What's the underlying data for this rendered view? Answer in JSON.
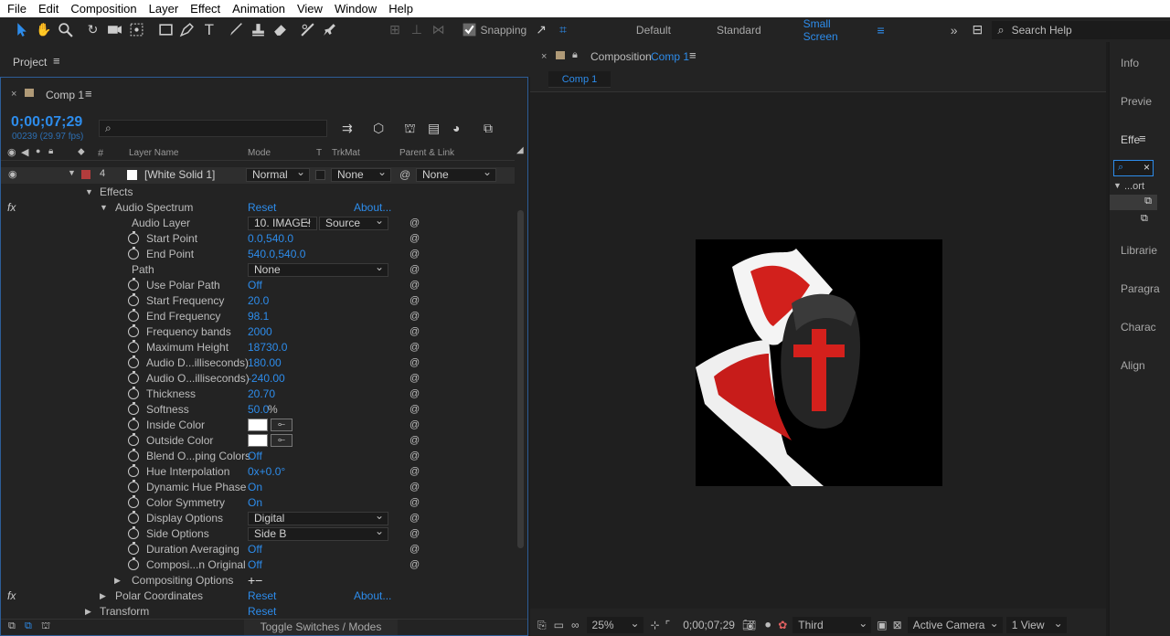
{
  "menu": [
    "File",
    "Edit",
    "Composition",
    "Layer",
    "Effect",
    "Animation",
    "View",
    "Window",
    "Help"
  ],
  "toolbar": {
    "snapping_label": "Snapping",
    "workspaces": [
      "Default",
      "Standard",
      "Small Screen"
    ],
    "search_placeholder": "Search Help"
  },
  "project": {
    "title": "Project",
    "comp_tab": "Comp 1",
    "timecode": "0;00;07;29",
    "frame_info": "00239 (29.97 fps)"
  },
  "timeline": {
    "headers": {
      "hash": "#",
      "layer_name": "Layer Name",
      "mode": "Mode",
      "t": "T",
      "trkmat": "TrkMat",
      "parent": "Parent & Link"
    },
    "layer": {
      "index": "4",
      "name": "[White Solid 1]",
      "mode": "Normal",
      "trkmat": "None",
      "parent": "None"
    },
    "effects_label": "Effects",
    "effect_name": "Audio Spectrum",
    "reset": "Reset",
    "about": "About...",
    "props": [
      {
        "label": "Audio Layer",
        "value": "10. IMAGE!",
        "value2": "Source",
        "type": "dual"
      },
      {
        "label": "Start Point",
        "value": "0.0,540.0",
        "type": "text"
      },
      {
        "label": "End Point",
        "value": "540.0,540.0",
        "type": "text"
      },
      {
        "label": "Path",
        "value": "None",
        "type": "dropdown"
      },
      {
        "label": "Use Polar Path",
        "value": "Off",
        "type": "text"
      },
      {
        "label": "Start Frequency",
        "value": "20.0",
        "type": "text"
      },
      {
        "label": "End Frequency",
        "value": "98.1",
        "type": "text"
      },
      {
        "label": "Frequency bands",
        "value": "2000",
        "type": "text"
      },
      {
        "label": "Maximum Height",
        "value": "18730.0",
        "type": "text"
      },
      {
        "label": "Audio D...illiseconds)",
        "value": "180.00",
        "type": "text"
      },
      {
        "label": "Audio O...illiseconds)",
        "value": "-240.00",
        "type": "text"
      },
      {
        "label": "Thickness",
        "value": "20.70",
        "type": "text"
      },
      {
        "label": "Softness",
        "value": "50.0",
        "suffix": "%",
        "type": "text"
      },
      {
        "label": "Inside Color",
        "type": "color"
      },
      {
        "label": "Outside Color",
        "type": "color"
      },
      {
        "label": "Blend O...ping Colors",
        "value": "Off",
        "type": "text"
      },
      {
        "label": "Hue Interpolation",
        "value": "0x+0.0°",
        "type": "text"
      },
      {
        "label": "Dynamic Hue Phase",
        "value": "On",
        "type": "text"
      },
      {
        "label": "Color Symmetry",
        "value": "On",
        "type": "text"
      },
      {
        "label": "Display Options",
        "value": "Digital",
        "type": "dropdown"
      },
      {
        "label": "Side Options",
        "value": "Side B",
        "type": "dropdown"
      },
      {
        "label": "Duration Averaging",
        "value": "Off",
        "type": "text"
      },
      {
        "label": "Composi...n Original",
        "value": "Off",
        "type": "text"
      }
    ],
    "compositing_options": "Compositing Options",
    "polar_coordinates": "Polar Coordinates",
    "transform": "Transform",
    "toggle_switches": "Toggle Switches / Modes"
  },
  "composition": {
    "label": "Composition",
    "name": "Comp 1",
    "tab": "Comp 1",
    "zoom": "25%",
    "timecode": "0;00;07;29",
    "resolution": "Third",
    "camera": "Active Camera",
    "views": "1 View"
  },
  "right_panels": [
    "Info",
    "Previe",
    "Effe",
    "Librarie",
    "Paragra",
    "Charac",
    "Align"
  ],
  "effects_search_item": "...ort"
}
